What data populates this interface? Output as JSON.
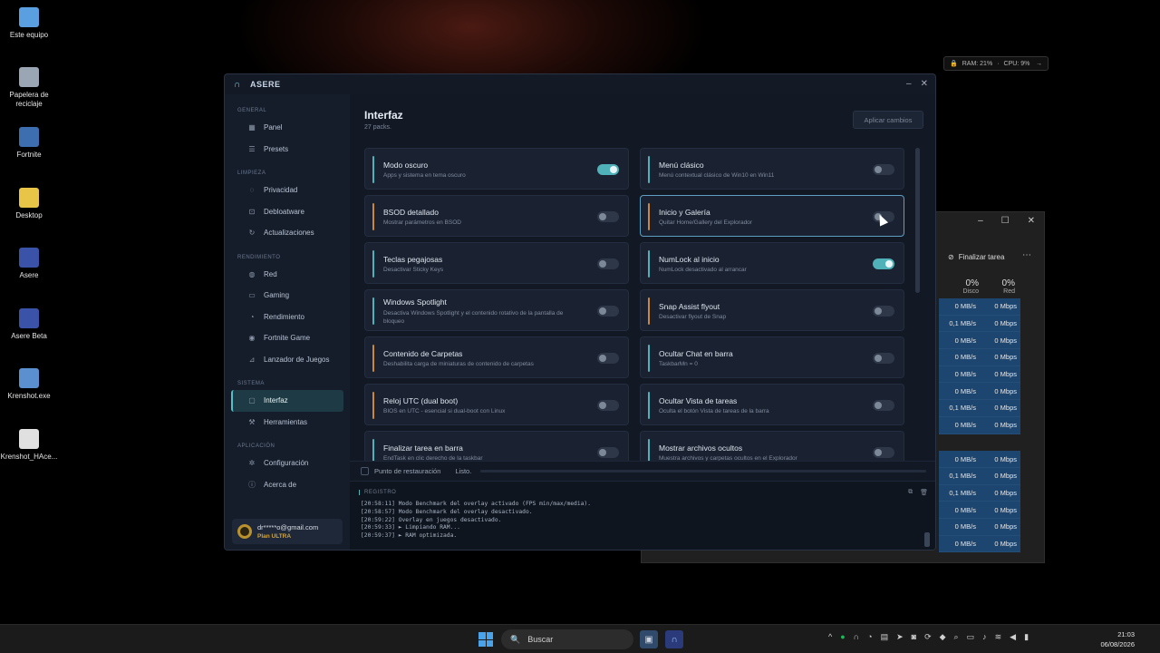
{
  "desktop": {
    "icons": [
      {
        "label": "Este equipo",
        "color": "#5aa0e0"
      },
      {
        "label": "Papelera de reciclaje",
        "color": "#9aa6b4"
      },
      {
        "label": "Fortnite",
        "color": "#3d6fb0"
      },
      {
        "label": "Desktop",
        "color": "#e8c547"
      },
      {
        "label": "Asere",
        "color": "#3a52a8"
      },
      {
        "label": "Asere Beta",
        "color": "#3a52a8"
      },
      {
        "label": "Krenshot.exe",
        "color": "#5a8fd0"
      },
      {
        "label": "Krenshot_HAce...",
        "color": "#e0e0e0"
      }
    ]
  },
  "perf_widget": {
    "ram": "RAM: 21%",
    "cpu": "CPU: 9%"
  },
  "taskmgr": {
    "end_task": "Finalizar tarea",
    "columns": [
      {
        "pct": "0%",
        "name": "Disco"
      },
      {
        "pct": "0%",
        "name": "Red"
      }
    ],
    "rows": [
      [
        "0 MB/s",
        "0 Mbps"
      ],
      [
        "0,1 MB/s",
        "0 Mbps"
      ],
      [
        "0 MB/s",
        "0 Mbps"
      ],
      [
        "0 MB/s",
        "0 Mbps"
      ],
      [
        "0 MB/s",
        "0 Mbps"
      ],
      [
        "0 MB/s",
        "0 Mbps"
      ],
      [
        "0,1 MB/s",
        "0 Mbps"
      ],
      [
        "0 MB/s",
        "0 Mbps"
      ],
      [
        "",
        ""
      ],
      [
        "0 MB/s",
        "0 Mbps"
      ],
      [
        "0,1 MB/s",
        "0 Mbps"
      ],
      [
        "0,1 MB/s",
        "0 Mbps"
      ],
      [
        "0 MB/s",
        "0 Mbps"
      ],
      [
        "0 MB/s",
        "0 Mbps"
      ],
      [
        "0 MB/s",
        "0 Mbps"
      ]
    ]
  },
  "app": {
    "title": "ASERE",
    "sidebar": {
      "sections": [
        {
          "label": "GENERAL",
          "items": [
            {
              "label": "Panel",
              "icon": "grid-icon"
            },
            {
              "label": "Presets",
              "icon": "sliders-icon"
            }
          ]
        },
        {
          "label": "LIMPIEZA",
          "items": [
            {
              "label": "Privacidad",
              "icon": "shield-icon"
            },
            {
              "label": "Debloatware",
              "icon": "trash-icon"
            },
            {
              "label": "Actualizaciones",
              "icon": "refresh-icon"
            }
          ]
        },
        {
          "label": "RENDIMIENTO",
          "items": [
            {
              "label": "Red",
              "icon": "globe-icon"
            },
            {
              "label": "Gaming",
              "icon": "gamepad-icon"
            },
            {
              "label": "Rendimiento",
              "icon": "speed-icon"
            },
            {
              "label": "Fortnite Game",
              "icon": "game-icon"
            },
            {
              "label": "Lanzador de Juegos",
              "icon": "rocket-icon"
            }
          ]
        },
        {
          "label": "SISTEMA",
          "items": [
            {
              "label": "Interfaz",
              "icon": "window-icon",
              "active": true
            },
            {
              "label": "Herramientas",
              "icon": "wrench-icon"
            }
          ]
        },
        {
          "label": "APLICACIÓN",
          "items": [
            {
              "label": "Configuración",
              "icon": "gear-icon"
            },
            {
              "label": "Acerca de",
              "icon": "info-icon"
            }
          ]
        }
      ],
      "account": {
        "email": "dr*****o@gmail.com",
        "plan": "Plan ULTRA"
      }
    },
    "main": {
      "title": "Interfaz",
      "subtitle": "27 packs.",
      "apply_label": "Aplicar cambios",
      "cards": [
        {
          "title": "Modo oscuro",
          "desc": "Apps y sistema en tema oscuro",
          "on": true,
          "accent": "#4fb2b8"
        },
        {
          "title": "Menú clásico",
          "desc": "Menú contextual clásico de Win10 en Win11",
          "on": false,
          "accent": "#4fb2b8"
        },
        {
          "title": "BSOD detallado",
          "desc": "Mostrar parámetros en BSOD",
          "on": false,
          "accent": "#c9893a"
        },
        {
          "title": "Inicio y Galería",
          "desc": "Quitar Home/Gallery del Explorador",
          "on": false,
          "accent": "#c9893a",
          "highlight": true
        },
        {
          "title": "Teclas pegajosas",
          "desc": "Desactivar Sticky Keys",
          "on": false,
          "accent": "#4fb2b8"
        },
        {
          "title": "NumLock al inicio",
          "desc": "NumLock desactivado al arrancar",
          "on": true,
          "accent": "#4fb2b8"
        },
        {
          "title": "Windows Spotlight",
          "desc": "Desactiva Windows Spotlight y el contenido rotativo de la pantalla de bloqueo",
          "on": false,
          "accent": "#4fb2b8",
          "two": true
        },
        {
          "title": "Snap Assist flyout",
          "desc": "Desactivar flyout de Snap",
          "on": false,
          "accent": "#c9893a"
        },
        {
          "title": "Contenido de Carpetas",
          "desc": "Deshabilita carga de miniaturas de contenido de carpetas",
          "on": false,
          "accent": "#c9893a"
        },
        {
          "title": "Ocultar Chat en barra",
          "desc": "TaskbarMn = 0",
          "on": false,
          "accent": "#4fb2b8"
        },
        {
          "title": "Reloj UTC (dual boot)",
          "desc": "BIOS en UTC - esencial si dual-boot con Linux",
          "on": false,
          "accent": "#c9893a"
        },
        {
          "title": "Ocultar Vista de tareas",
          "desc": "Oculta el botón Vista de tareas de la barra",
          "on": false,
          "accent": "#4fb2b8"
        },
        {
          "title": "Finalizar tarea en barra",
          "desc": "EndTask en clic derecho de la taskbar",
          "on": false,
          "accent": "#4fb2b8"
        },
        {
          "title": "Mostrar archivos ocultos",
          "desc": "Muestra archivos y carpetas ocultos en el Explorador",
          "on": false,
          "accent": "#4fb2b8"
        }
      ],
      "restore_label": "Punto de restauración",
      "status": "Listo."
    },
    "log": {
      "header": "REGISTRO",
      "lines": [
        "[20:58:11] Modo Benchmark del overlay activado (FPS min/max/media).",
        "[20:58:57] Modo Benchmark del overlay desactivado.",
        "[20:59:22] Overlay en juegos desactivado.",
        "[20:59:33] ► Limpiando RAM...",
        "[20:59:37] ► RAM optimizada."
      ]
    }
  },
  "taskbar": {
    "search_placeholder": "Buscar",
    "time": "21:03",
    "date": "06/08/2026"
  }
}
